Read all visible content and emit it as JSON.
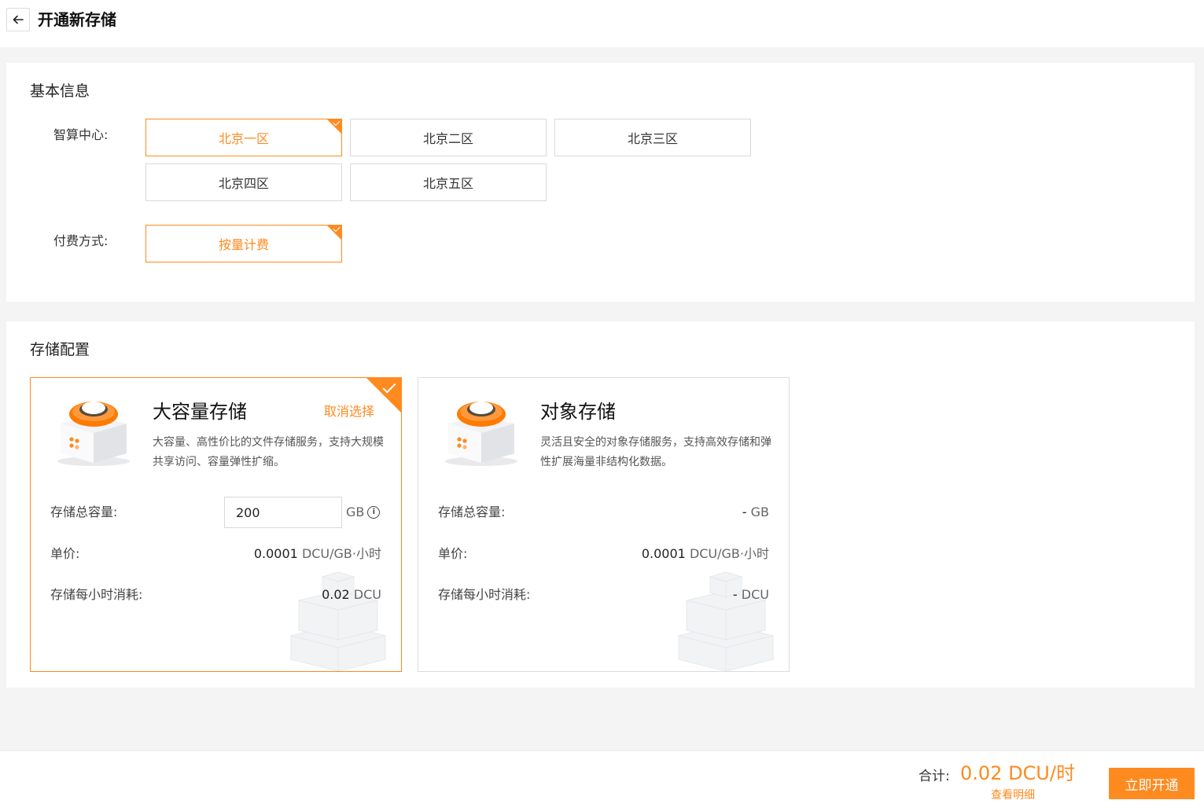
{
  "header": {
    "title": "开通新存储",
    "back_icon": "arrow-left-icon"
  },
  "basic": {
    "title": "基本信息",
    "region_label": "智算中心:",
    "regions": [
      "北京一区",
      "北京二区",
      "北京三区",
      "北京四区",
      "北京五区"
    ],
    "selected_region": "北京一区",
    "billing_label": "付费方式:",
    "billing_options": [
      "按量计费"
    ],
    "selected_billing": "按量计费"
  },
  "storage": {
    "title": "存储配置",
    "cards": [
      {
        "name": "大容量存储",
        "selected": true,
        "cancel_label": "取消选择",
        "desc": "大容量、高性价比的文件存储服务，支持大规模共享访问、容量弹性扩缩。",
        "capacity_label": "存储总容量:",
        "capacity_value": "200",
        "capacity_unit": "GB",
        "price_label": "单价:",
        "price_num": "0.0001",
        "price_unit": "DCU/GB·小时",
        "hourly_label": "存储每小时消耗:",
        "hourly_num": "0.02",
        "hourly_unit": "DCU"
      },
      {
        "name": "对象存储",
        "selected": false,
        "desc": "灵活且安全的对象存储服务，支持高效存储和弹性扩展海量非结构化数据。",
        "capacity_label": "存储总容量:",
        "capacity_value": "-",
        "capacity_unit": "GB",
        "price_label": "单价:",
        "price_num": "0.0001",
        "price_unit": "DCU/GB·小时",
        "hourly_label": "存储每小时消耗:",
        "hourly_num": "-",
        "hourly_unit": "DCU"
      }
    ]
  },
  "footer": {
    "total_label": "合计:",
    "total_value": "0.02 DCU/时",
    "detail_label": "查看明细",
    "submit_label": "立即开通"
  },
  "colors": {
    "accent": "#ff8a1f",
    "border": "#d9d9d9",
    "background": "#f4f4f4"
  }
}
